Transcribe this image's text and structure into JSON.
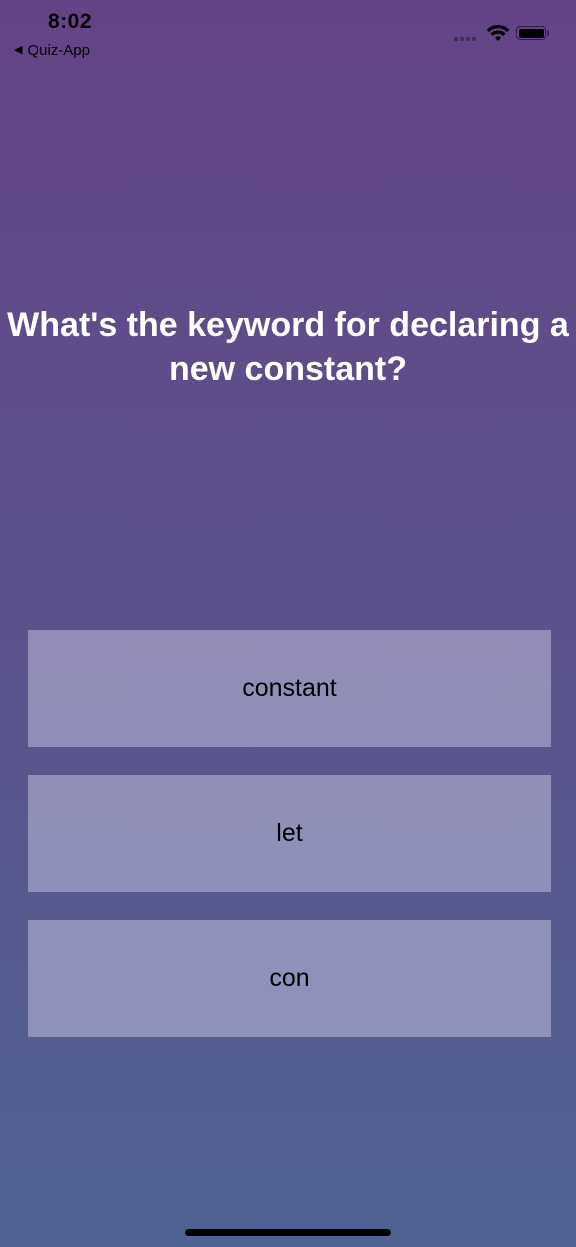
{
  "status_bar": {
    "time": "8:02",
    "back_label": "Quiz-App"
  },
  "question": {
    "text": "What's the keyword for declaring a new constant?"
  },
  "answers": [
    {
      "label": "constant"
    },
    {
      "label": "let"
    },
    {
      "label": "con"
    }
  ],
  "colors": {
    "background_top": "#644487",
    "background_bottom": "#506393",
    "question_text": "#ffffff",
    "answer_text": "#000000"
  }
}
